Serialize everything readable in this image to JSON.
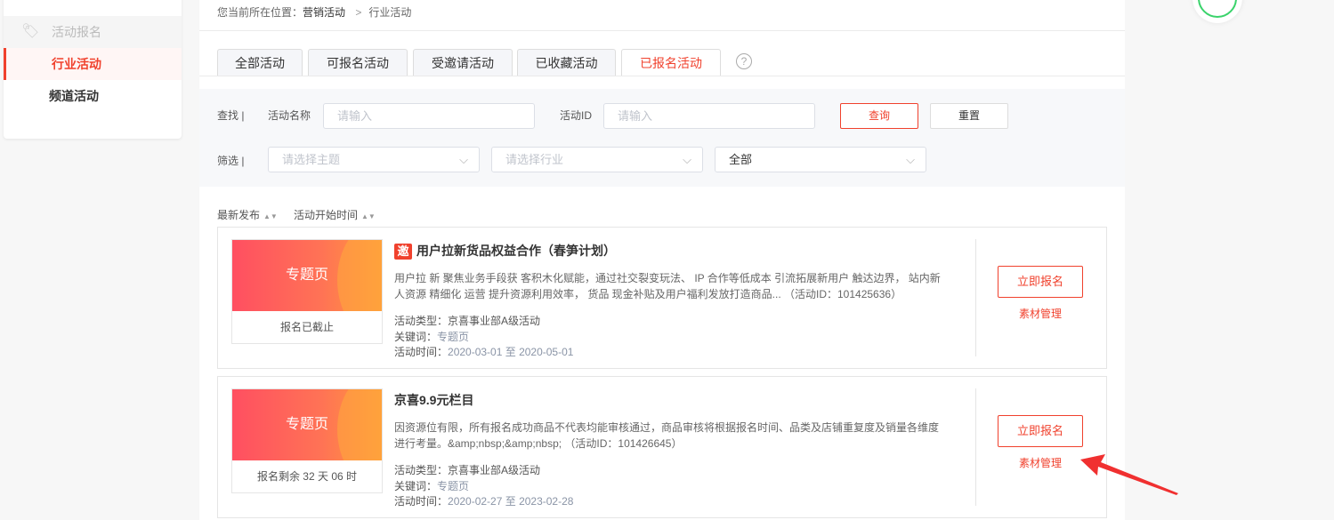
{
  "sidebar": {
    "group": "活动报名",
    "items": [
      {
        "label": "行业活动",
        "active": true
      },
      {
        "label": "频道活动",
        "active": false
      }
    ]
  },
  "breadcrumb": {
    "prefix": "您当前所在位置：",
    "parent": "营销活动",
    "separator": ">",
    "current": "行业活动"
  },
  "tabs": [
    {
      "label": "全部活动"
    },
    {
      "label": "可报名活动"
    },
    {
      "label": "受邀请活动"
    },
    {
      "label": "已收藏活动"
    },
    {
      "label": "已报名活动",
      "active": true
    }
  ],
  "help_icon": "?",
  "search": {
    "label": "查找 |",
    "name_label": "活动名称",
    "name_placeholder": "请输入",
    "id_label": "活动ID",
    "id_placeholder": "请输入",
    "query_button": "查询",
    "reset_button": "重置"
  },
  "filter": {
    "label": "筛选 |",
    "topic_placeholder": "请选择主题",
    "industry_placeholder": "请选择行业",
    "status_value": "全部"
  },
  "sort": [
    {
      "label": "最新发布"
    },
    {
      "label": "活动开始时间"
    }
  ],
  "cards": [
    {
      "thumb": "专题页",
      "status": "报名已截止",
      "badge": "邀",
      "title": "用户拉新货品权益合作（春笋计划）",
      "desc": "用户拉 新 聚焦业务手段获 客积木化赋能，通过社交裂变玩法、 IP 合作等低成本 引流拓展新用户 触达边界， 站内新人资源 精细化 运营 提升资源利用效率， 货品 现金补贴及用户福利发放打造商品... （活动ID：101425636）",
      "type_label": "活动类型：",
      "type_value": "京喜事业部A级活动",
      "kw_label": "关键词：",
      "kw_value": "专题页",
      "time_label": "活动时间：",
      "time_value": "2020-03-01 至 2020-05-01",
      "signup": "立即报名",
      "material": "素材管理"
    },
    {
      "thumb": "专题页",
      "status": "报名剩余 32 天 06 时",
      "badge": "",
      "title": "京喜9.9元栏目",
      "desc": "因资源位有限，所有报名成功商品不代表均能审核通过，商品审核将根据报名时间、品类及店铺重复度及销量各维度进行考量。&amp;nbsp;&amp;nbsp; （活动ID：101426645）",
      "type_label": "活动类型：",
      "type_value": "京喜事业部A级活动",
      "kw_label": "关键词：",
      "kw_value": "专题页",
      "time_label": "活动时间：",
      "time_value": "2020-02-27 至 2023-02-28",
      "signup": "立即报名",
      "material": "素材管理"
    }
  ],
  "colors": {
    "accent": "#f0412d",
    "annotation_arrow": "#f03030"
  }
}
